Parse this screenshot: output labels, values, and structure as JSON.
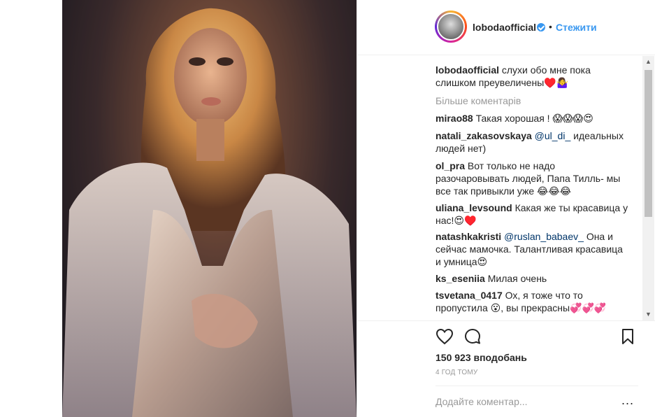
{
  "post": {
    "username": "lobodaofficial",
    "separator": "•",
    "follow_label": "Стежити"
  },
  "caption": {
    "username": "lobodaofficial",
    "text_line1": "слухи обо мне пока",
    "text_line2": "слишком преувеличены♥️🤷‍♀️"
  },
  "load_more": "Більше коментарів",
  "comments": [
    {
      "user": "mirao88",
      "l1": "Такая хорошая ! 😱😱😱😍"
    },
    {
      "user": "natali_zakasovskaya",
      "mention": "@ul_di_",
      "l1": "идеальных",
      "l2": "людей нет)"
    },
    {
      "user": "ol_pra",
      "l1": "Вот только не надо",
      "l2": "разочаровывать людей, Папа Тилль- мы",
      "l3": "все так привыкли уже 😂😂😂"
    },
    {
      "user": "uliana_levsound",
      "l1": "Какая же ты красавица у",
      "l2": "нас!😍♥️"
    },
    {
      "user": "natashkakristi",
      "mention": "@ruslan_babaev_",
      "l1": "Она и",
      "l2": "сейчас мамочка. Талантливая красавица",
      "l3": "и умница😍"
    },
    {
      "user": "ks_eseniia",
      "l1": "Милая очень"
    },
    {
      "user": "tsvetana_0417",
      "l1": "Ох, я тоже что то",
      "l2": "пропустила 😮, вы прекрасны💞💞💞"
    }
  ],
  "stats": {
    "likes": "150 923 вподобань",
    "time_ago": "4 ГОД ТОМУ"
  },
  "add_comment": {
    "placeholder": "Додайте коментар...",
    "more": "..."
  },
  "icons": {
    "like": "heart-icon",
    "comment": "comment-bubble-icon",
    "save": "bookmark-icon",
    "verified": "verified-badge-icon"
  }
}
